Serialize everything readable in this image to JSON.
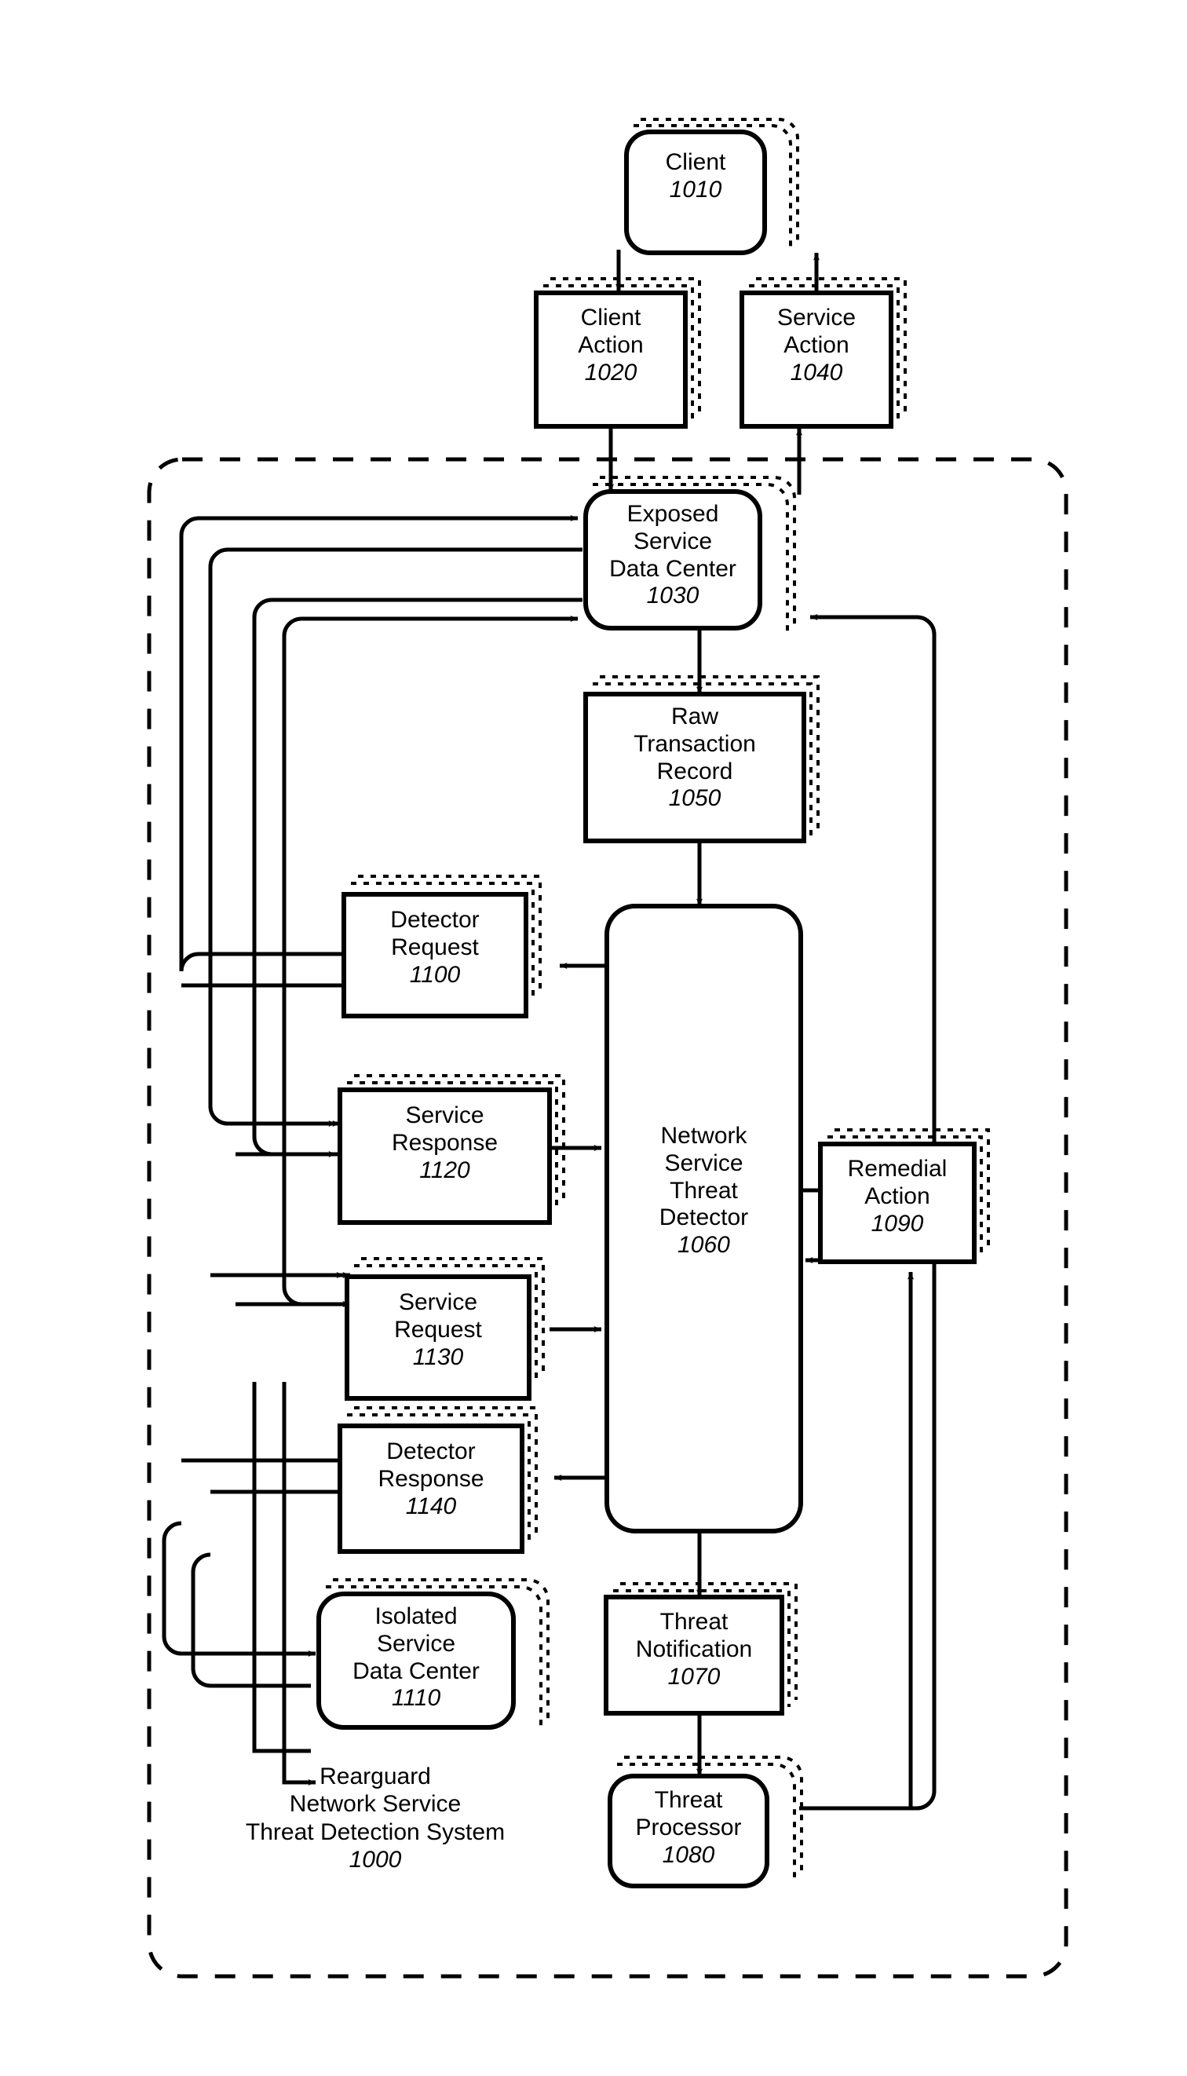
{
  "figure": {
    "title_caption": {
      "line1": "Rearguard",
      "line2": "Network Service",
      "line3": "Threat Detection System",
      "ref": "1000"
    },
    "boundary": {
      "style": "dashed-rounded-rectangle",
      "label": "Rearguard Network Service Threat Detection System 1000"
    }
  },
  "nodes": {
    "client": {
      "line1": "Client",
      "line2": "",
      "line3": "",
      "ref": "1010",
      "shape": "rounded",
      "stacked": true
    },
    "client_action": {
      "line1": "Client",
      "line2": "Action",
      "line3": "",
      "ref": "1020",
      "shape": "rect",
      "stacked": true
    },
    "service_action": {
      "line1": "Service",
      "line2": "Action",
      "line3": "",
      "ref": "1040",
      "shape": "rect",
      "stacked": true
    },
    "exposed_dc": {
      "line1": "Exposed",
      "line2": "Service",
      "line3": "Data Center",
      "ref": "1030",
      "shape": "rounded",
      "stacked": true
    },
    "raw_txn": {
      "line1": "Raw",
      "line2": "Transaction",
      "line3": "Record",
      "ref": "1050",
      "shape": "rect",
      "stacked": true
    },
    "detector_request": {
      "line1": "Detector",
      "line2": "Request",
      "line3": "",
      "ref": "1100",
      "shape": "rect",
      "stacked": true
    },
    "service_response": {
      "line1": "Service",
      "line2": "Response",
      "line3": "",
      "ref": "1120",
      "shape": "rect",
      "stacked": true
    },
    "service_request": {
      "line1": "Service",
      "line2": "Request",
      "line3": "",
      "ref": "1130",
      "shape": "rect",
      "stacked": true
    },
    "detector_response": {
      "line1": "Detector",
      "line2": "Response",
      "line3": "",
      "ref": "1140",
      "shape": "rect",
      "stacked": true
    },
    "isolated_dc": {
      "line1": "Isolated",
      "line2": "Service",
      "line3": "Data Center",
      "ref": "1110",
      "shape": "rounded",
      "stacked": true
    },
    "detector": {
      "line1": "Network",
      "line2": "Service",
      "line3": "Threat",
      "line4": "Detector",
      "ref": "1060",
      "shape": "rounded",
      "stacked": false
    },
    "remedial": {
      "line1": "Remedial",
      "line2": "Action",
      "line3": "",
      "ref": "1090",
      "shape": "rect",
      "stacked": true
    },
    "threat_notification": {
      "line1": "Threat",
      "line2": "Notification",
      "line3": "",
      "ref": "1070",
      "shape": "rect",
      "stacked": true
    },
    "threat_processor": {
      "line1": "Threat",
      "line2": "Processor",
      "line3": "",
      "ref": "1080",
      "shape": "rounded",
      "stacked": true
    }
  },
  "colors": {
    "ink": "#000000",
    "paper": "#ffffff"
  }
}
